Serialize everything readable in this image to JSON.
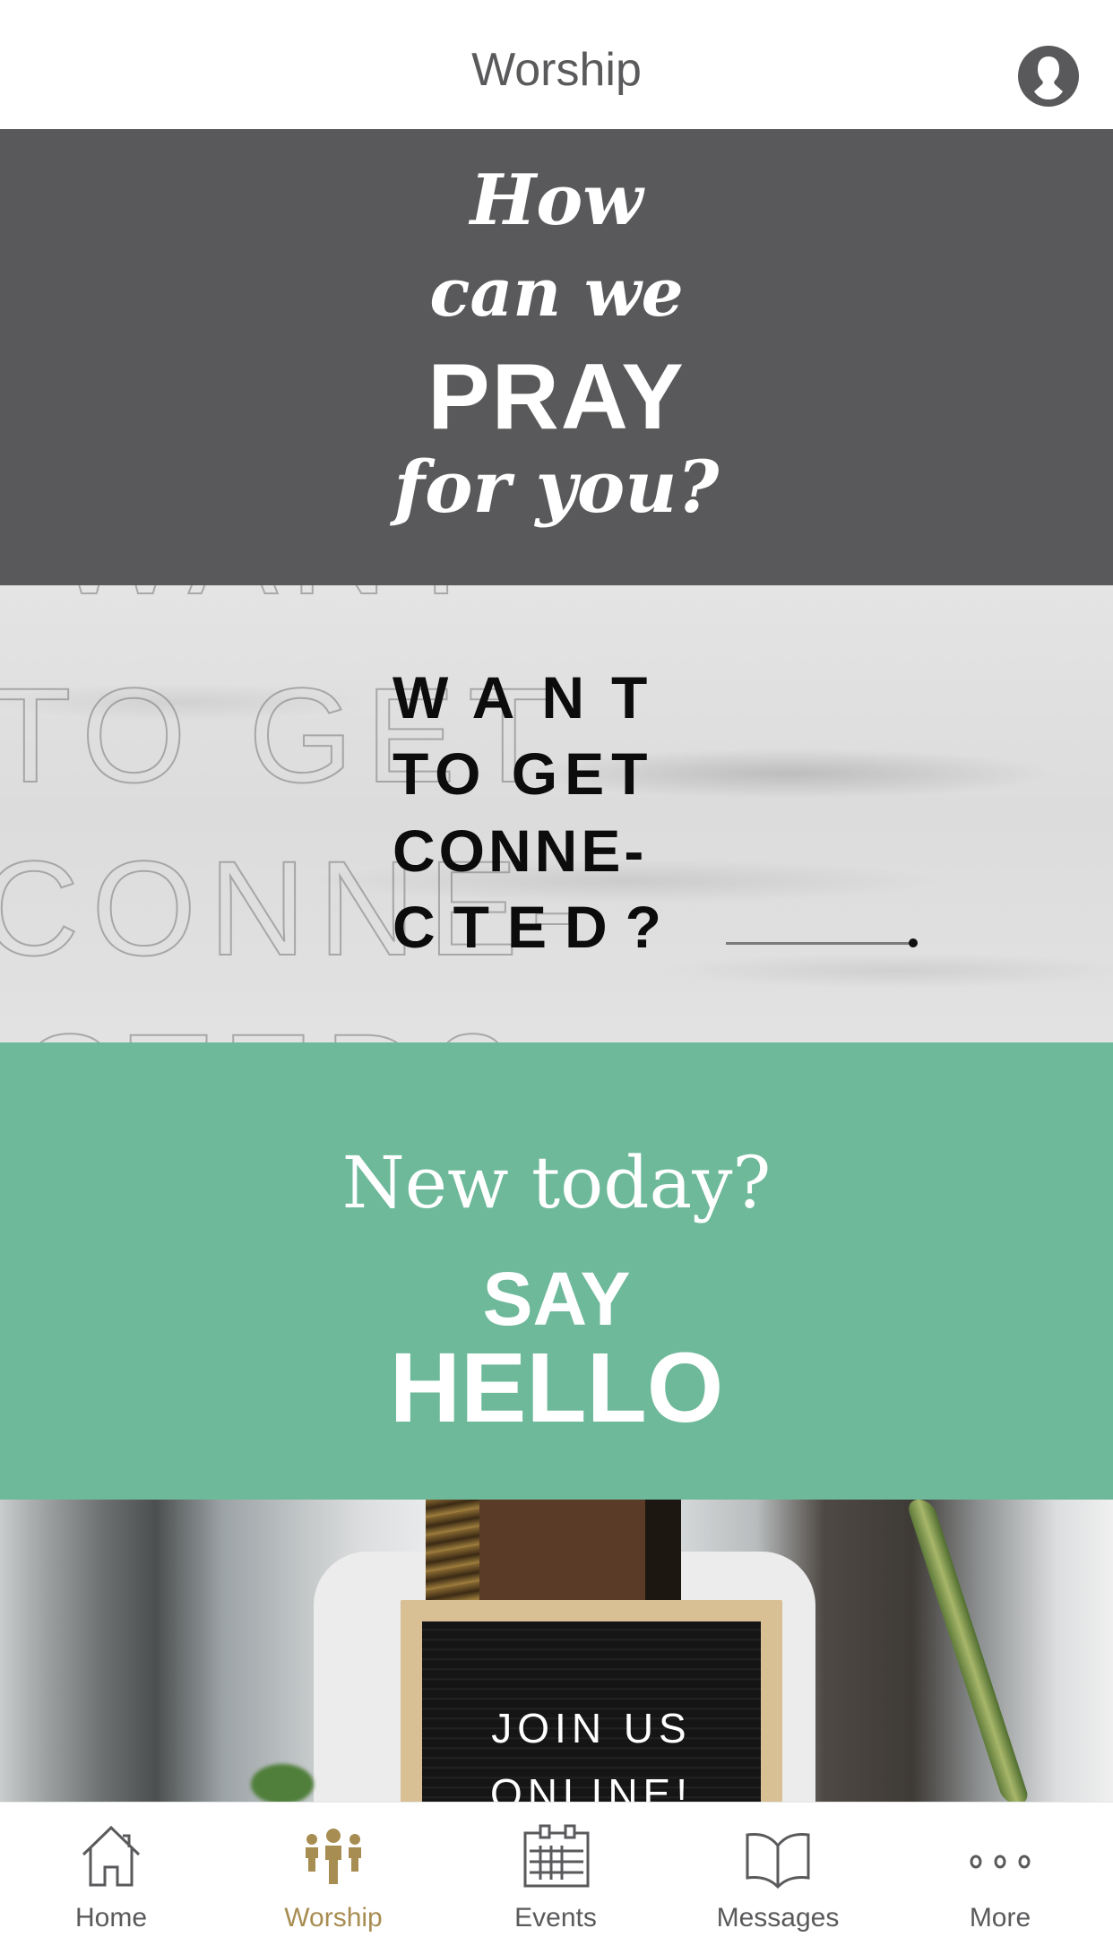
{
  "header": {
    "title": "Worship",
    "profile_icon": "person-circle-icon"
  },
  "feed": {
    "cards": [
      {
        "id": "prayer",
        "background": "#59595b",
        "lines": [
          "How",
          "can we",
          "PRAY",
          "for you?"
        ]
      },
      {
        "id": "connected",
        "background": "#e0e0e0",
        "ghost_lines": [
          "WANT",
          "TO GET",
          "CONNE-",
          "CTED?"
        ],
        "lines": [
          "WANT",
          "TO GET",
          "CONNE-",
          "CTED?"
        ]
      },
      {
        "id": "new-today",
        "background": "#6db99a",
        "lines": [
          "New today?",
          "SAY",
          "HELLO"
        ]
      },
      {
        "id": "join-online",
        "image_description": "Person holding a letter board",
        "board_lines": [
          "JOIN US",
          "ONLINE!"
        ]
      }
    ]
  },
  "tabbar": {
    "active_color": "#a88d52",
    "inactive_color": "#5a5a5c",
    "tabs": [
      {
        "label": "Home",
        "icon": "house-icon",
        "active": false
      },
      {
        "label": "Worship",
        "icon": "people-icon",
        "active": true
      },
      {
        "label": "Events",
        "icon": "calendar-icon",
        "active": false
      },
      {
        "label": "Messages",
        "icon": "open-book-icon",
        "active": false
      },
      {
        "label": "More",
        "icon": "more-dots-icon",
        "active": false
      }
    ]
  }
}
